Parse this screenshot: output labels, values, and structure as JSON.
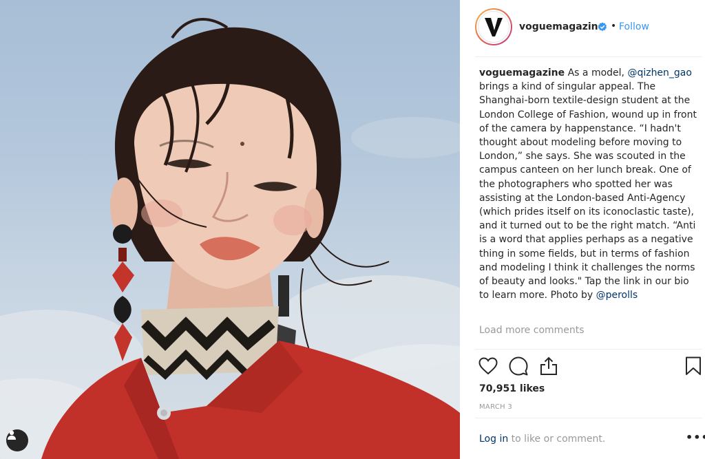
{
  "post": {
    "username": "voguemagazine",
    "dot": "•",
    "follow_label": "Follow",
    "caption": {
      "username": "voguemagazine",
      "part1": " As a model, ",
      "mention1": "@qizhen_gao",
      "part2": " brings a kind of singular appeal. The Shanghai-born textile-design student at the London College of Fashion, wound up in front of the camera by happenstance. “I hadn't thought about modeling before moving to London,” she says. She was scouted in the campus canteen on her lunch break. One of the photographers who spotted her was assisting at the London-based Anti-Agency (which prides itself on its iconoclastic taste), and it turned out to be the right match. “Anti is a word that applies perhaps as a negative thing in some fields, but in terms of fashion and modeling I think it challenges the norms of beauty and looks.\" Tap the link in our bio to learn more. Photo by ",
      "mention2": "@perolls"
    },
    "load_more_label": "Load more comments",
    "likes": "70,951 likes",
    "date": "MARCH 3",
    "login_link": "Log in",
    "login_suffix": " to like or comment.",
    "more_label": "•••"
  },
  "icons": {
    "heart": "heart-icon",
    "comment": "comment-icon",
    "share": "share-icon",
    "bookmark": "bookmark-icon",
    "verified": "verified-badge-icon",
    "user": "user-icon"
  },
  "colors": {
    "link": "#3897f0",
    "mention": "#003569",
    "muted": "#999999",
    "text": "#262626",
    "jacket": "#c2302a"
  }
}
